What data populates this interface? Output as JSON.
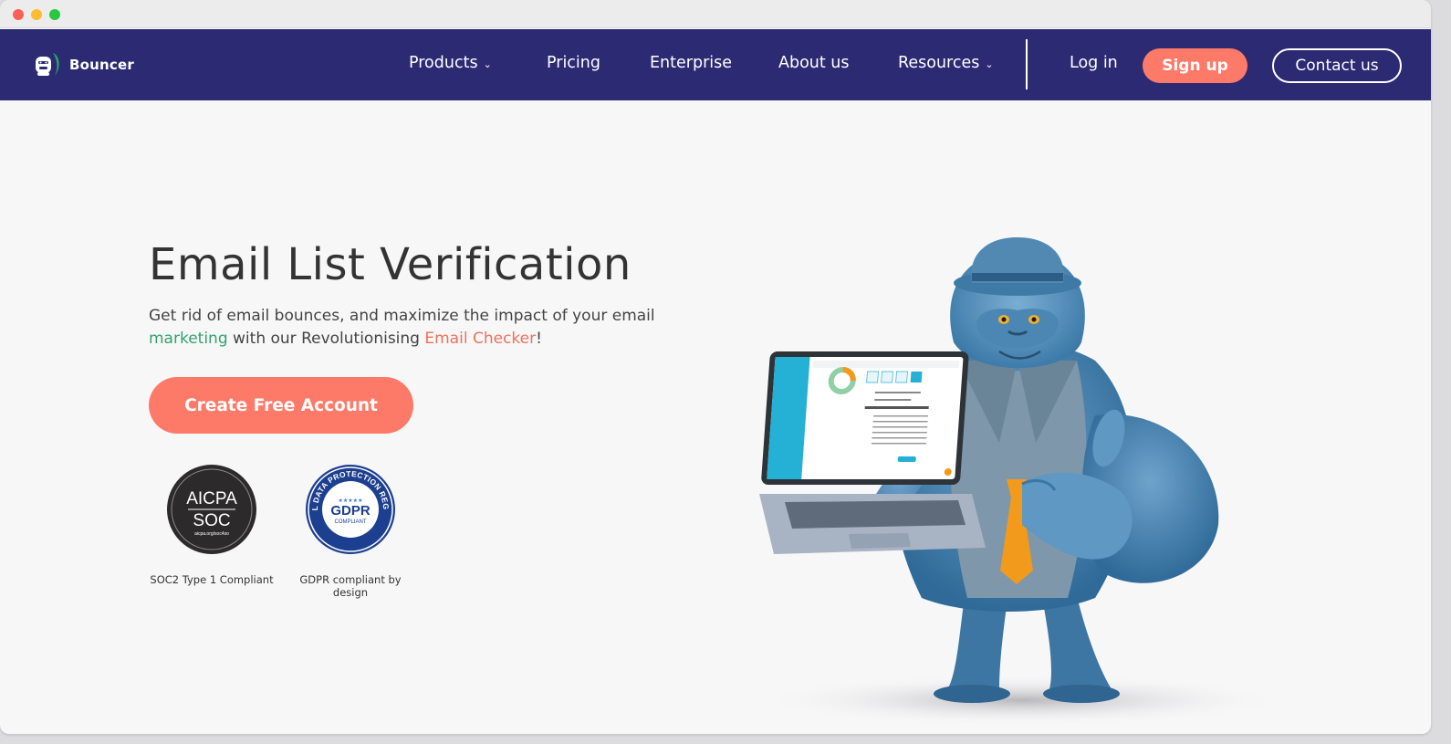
{
  "brand": {
    "name": "Bouncer"
  },
  "nav": {
    "items": [
      {
        "label": "Products",
        "has_dropdown": true
      },
      {
        "label": "Pricing",
        "has_dropdown": false
      },
      {
        "label": "Enterprise",
        "has_dropdown": false
      },
      {
        "label": "About us",
        "has_dropdown": false
      },
      {
        "label": "Resources",
        "has_dropdown": true
      }
    ],
    "login": "Log in",
    "signup": "Sign up",
    "contact": "Contact us"
  },
  "hero": {
    "title": "Email List Verification",
    "subtitle_part1": "Get rid of email bounces, and maximize the impact of your email ",
    "subtitle_highlight1": "marketing",
    "subtitle_part2": " with our Revolutionising ",
    "subtitle_highlight2": "Email Checker",
    "subtitle_part3": "!",
    "cta": "Create Free Account"
  },
  "badges": {
    "soc": {
      "seal_line1": "AICPA",
      "seal_line2": "SOC",
      "seal_small": "aicpa.org/soc4so",
      "caption": "SOC2 Type 1 Compliant"
    },
    "gdpr": {
      "seal_main": "GDPR",
      "seal_sub": "COMPLIANT",
      "seal_ring": "GENERAL DATA PROTECTION REGULATION",
      "seal_stars": "★★★★★",
      "caption": "GDPR compliant by design"
    }
  },
  "colors": {
    "nav_bg": "#2b2a73",
    "accent_coral": "#fe7a68",
    "accent_green": "#2fa46a",
    "page_bg": "#f7f7f8",
    "mascot_blue": "#4f88b3",
    "tie_orange": "#f29a1c"
  },
  "icons": {
    "chevron": "chevron-down-icon",
    "logo": "gorilla-logo-icon"
  }
}
